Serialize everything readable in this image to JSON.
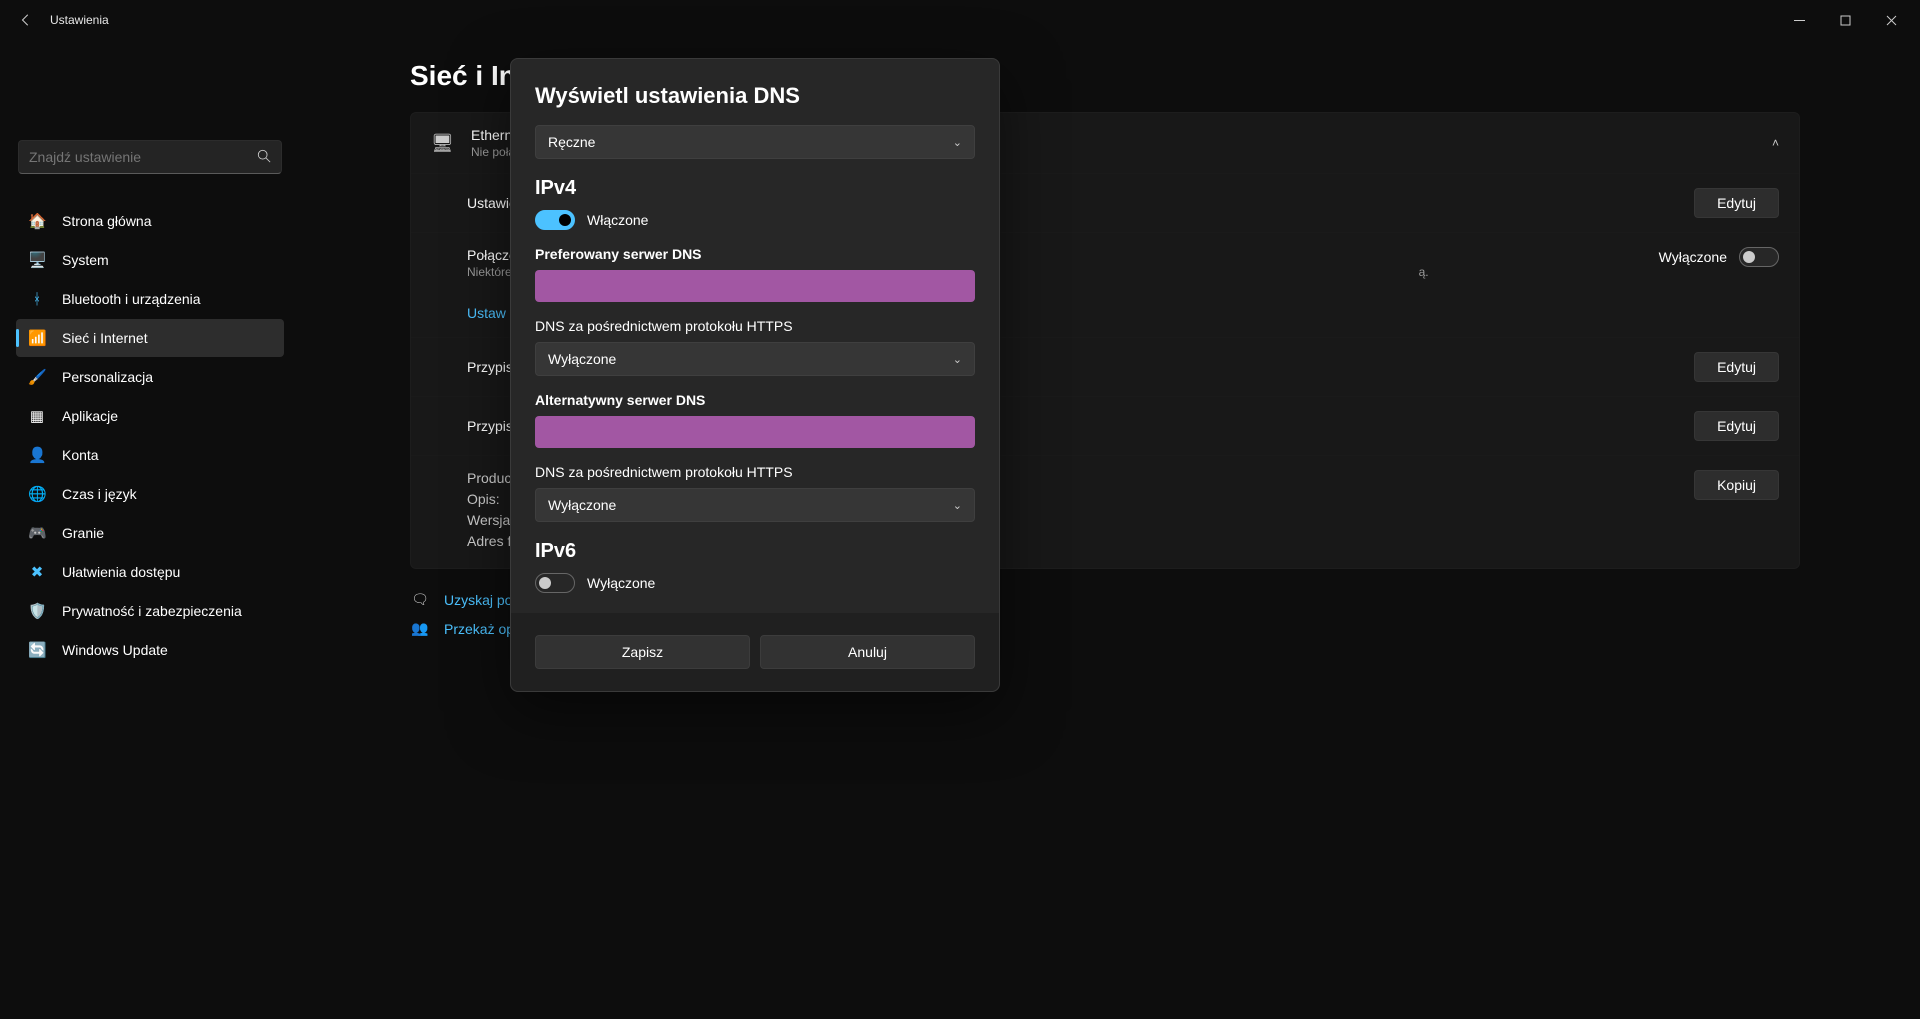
{
  "titlebar": {
    "app_name": "Ustawienia"
  },
  "search": {
    "placeholder": "Znajdź ustawienie"
  },
  "sidebar": {
    "items": [
      {
        "icon": "🏠",
        "label": "Strona główna"
      },
      {
        "icon": "🖥️",
        "label": "System"
      },
      {
        "icon": "ᚼ",
        "label": "Bluetooth i urządzenia",
        "icon_color": "#4cc2ff"
      },
      {
        "icon": "📶",
        "label": "Sieć i Internet",
        "icon_color": "#4cc2ff",
        "active": true
      },
      {
        "icon": "🖌️",
        "label": "Personalizacja"
      },
      {
        "icon": "▦",
        "label": "Aplikacje"
      },
      {
        "icon": "👤",
        "label": "Konta",
        "icon_color": "#7cc97c"
      },
      {
        "icon": "🌐",
        "label": "Czas i język"
      },
      {
        "icon": "🎮",
        "label": "Granie"
      },
      {
        "icon": "✖",
        "label": "Ułatwienia dostępu",
        "icon_color": "#4cc2ff"
      },
      {
        "icon": "🛡️",
        "label": "Prywatność i zabezpieczenia"
      },
      {
        "icon": "🔄",
        "label": "Windows Update",
        "icon_color": "#4cc2ff"
      }
    ]
  },
  "page": {
    "title": "Sieć i Int",
    "ethernet": {
      "name": "Etherne",
      "status": "Nie poła"
    },
    "rows": {
      "settings_label": "Ustawie",
      "metered_label": "Połącze",
      "metered_sub": "Niektóre",
      "metered_trail": "ą.",
      "metered_value": "Wyłączone",
      "set_link": "Ustaw",
      "assign1": "Przypis",
      "assign2": "Przypis",
      "product": "Produc",
      "desc": "Opis:",
      "version": "Wersja",
      "macaddr": "Adres f"
    },
    "buttons": {
      "edit": "Edytuj",
      "copy": "Kopiuj"
    },
    "help": {
      "get_help": "Uzyskaj po",
      "feedback": "Przekaż op"
    }
  },
  "modal": {
    "title": "Wyświetl ustawienia DNS",
    "mode": "Ręczne",
    "ipv4": {
      "heading": "IPv4",
      "state_label": "Włączone",
      "preferred_label": "Preferowany serwer DNS",
      "doh_label": "DNS za pośrednictwem protokołu HTTPS",
      "doh_value": "Wyłączone",
      "alt_label": "Alternatywny serwer DNS",
      "doh2_value": "Wyłączone"
    },
    "ipv6": {
      "heading": "IPv6",
      "state_label": "Wyłączone"
    },
    "footer": {
      "save": "Zapisz",
      "cancel": "Anuluj"
    }
  }
}
